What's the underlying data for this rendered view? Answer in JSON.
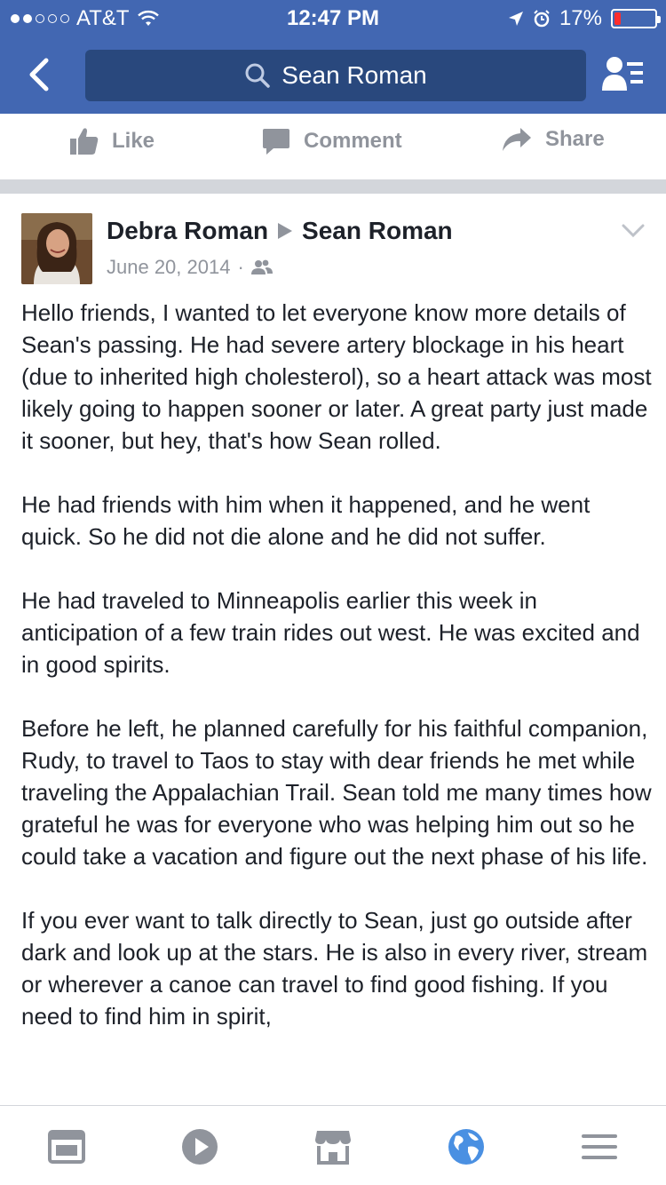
{
  "status_bar": {
    "carrier": "AT&T",
    "time": "12:47 PM",
    "battery": "17%",
    "battery_level": 0.17,
    "signal_bars": 2,
    "icons": [
      "wifi-icon",
      "location-arrow-icon",
      "alarm-icon",
      "battery-icon"
    ]
  },
  "nav": {
    "search_text": "Sean Roman",
    "icons": [
      "back-chevron-icon",
      "search-icon",
      "friend-requests-icon"
    ]
  },
  "actions": {
    "like": "Like",
    "comment": "Comment",
    "share": "Share"
  },
  "post": {
    "author": "Debra Roman",
    "target": "Sean Roman",
    "date": "June 20, 2014",
    "separator": "·",
    "audience_icon": "friends-icon",
    "paragraphs": [
      "Hello friends, I wanted to let everyone know more details of Sean's passing.  He had severe artery blockage in his heart (due to inherited high cholesterol), so a heart attack was most likely going to happen sooner or later.  A great party just made it sooner, but hey, that's how Sean rolled.",
      "He had friends with him when it happened, and he went quick.  So he did not die alone and he did not suffer.",
      "He had traveled to Minneapolis earlier this week in anticipation of a few train rides out west.  He was excited and in good spirits.",
      "Before he left, he planned carefully for his faithful companion, Rudy, to travel to Taos to stay with dear friends he met while traveling the Appalachian Trail.  Sean told me many times how grateful he was for everyone who was helping him out so he could take a vacation and figure out the next phase of his life.",
      "If you ever want to talk directly to Sean, just go outside after dark and look up at the stars.  He is also in every river, stream or wherever a canoe can travel to find good fishing.  If you need to find him in spirit,"
    ]
  },
  "tabbar": {
    "tabs": [
      "news-feed-icon",
      "video-icon",
      "marketplace-icon",
      "notifications-globe-icon",
      "menu-icon"
    ],
    "active": "notifications-globe-icon"
  },
  "colors": {
    "brand": "#4267b2",
    "search_bg": "#29487d",
    "muted": "#90949c",
    "text": "#1d2129",
    "active_tab": "#4a90e2"
  }
}
